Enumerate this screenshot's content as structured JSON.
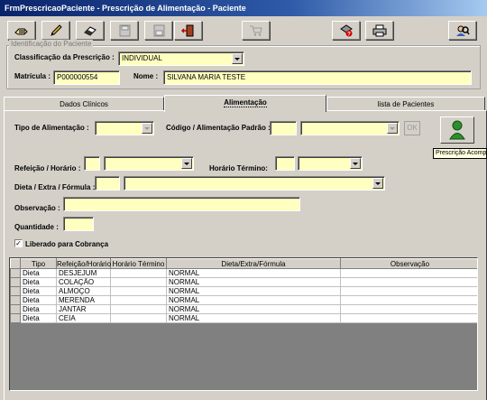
{
  "window": {
    "title": "FrmPrescricaoPaciente - Prescrição de Alimentação - Paciente"
  },
  "toolbar": {
    "buttons": [
      {
        "icon": "open-hand-icon"
      },
      {
        "icon": "pencil-icon"
      },
      {
        "icon": "eraser-icon"
      },
      {
        "icon": "save-disk-icon"
      },
      {
        "icon": "cancel-disk-icon"
      },
      {
        "icon": "exit-door-icon"
      },
      {
        "icon": "cart-icon"
      },
      {
        "icon": "help-tools-icon"
      },
      {
        "icon": "printer-icon"
      },
      {
        "icon": "search-people-icon"
      }
    ]
  },
  "patient": {
    "group_label": "Identificação do Paciente",
    "classification_label": "Classificação da Prescrição :",
    "classification_value": "INDIVIDUAL",
    "matricula_label": "Matrícula :",
    "matricula_value": "P000000554",
    "name_label": "Nome :",
    "name_value": "SILVANA MARIA TESTE"
  },
  "tabs": [
    {
      "label": "Dados Clínicos",
      "active": false
    },
    {
      "label": "Alimentação",
      "active": true
    },
    {
      "label": "lista de Pacientes",
      "active": false
    }
  ],
  "form": {
    "tipo_label": "Tipo de Alimentação :",
    "codigo_label": "Código / Alimentação Padrão :",
    "ok_label": "OK",
    "refeicao_label": "Refeição / Horário :",
    "horario_termino_label": "Horário Término:",
    "dieta_label": "Dieta / Extra / Fórmula :",
    "observacao_label": "Observação :",
    "quantidade_label": "Quantidade :",
    "liberado_label": "Liberado para Cobrança",
    "liberado_checked": true,
    "tooltip": "Prescrição Acompanhante"
  },
  "grid": {
    "columns": [
      "Tipo",
      "Refeição/Horário",
      "Horário Término",
      "Dieta/Extra/Fórmula",
      "Observação"
    ],
    "rows": [
      [
        "Dieta",
        "DESJEJUM",
        "",
        "NORMAL",
        ""
      ],
      [
        "Dieta",
        "COLAÇÃO",
        "",
        "NORMAL",
        ""
      ],
      [
        "Dieta",
        "ALMOÇO",
        "",
        "NORMAL",
        ""
      ],
      [
        "Dieta",
        "MERENDA",
        "",
        "NORMAL",
        ""
      ],
      [
        "Dieta",
        "JANTAR",
        "",
        "NORMAL",
        ""
      ],
      [
        "Dieta",
        "CEIA",
        "",
        "NORMAL",
        ""
      ]
    ]
  },
  "colors": {
    "field_bg": "#ffffc0",
    "window_bg": "#d4d0c8",
    "titlebar": "#0a246a"
  }
}
